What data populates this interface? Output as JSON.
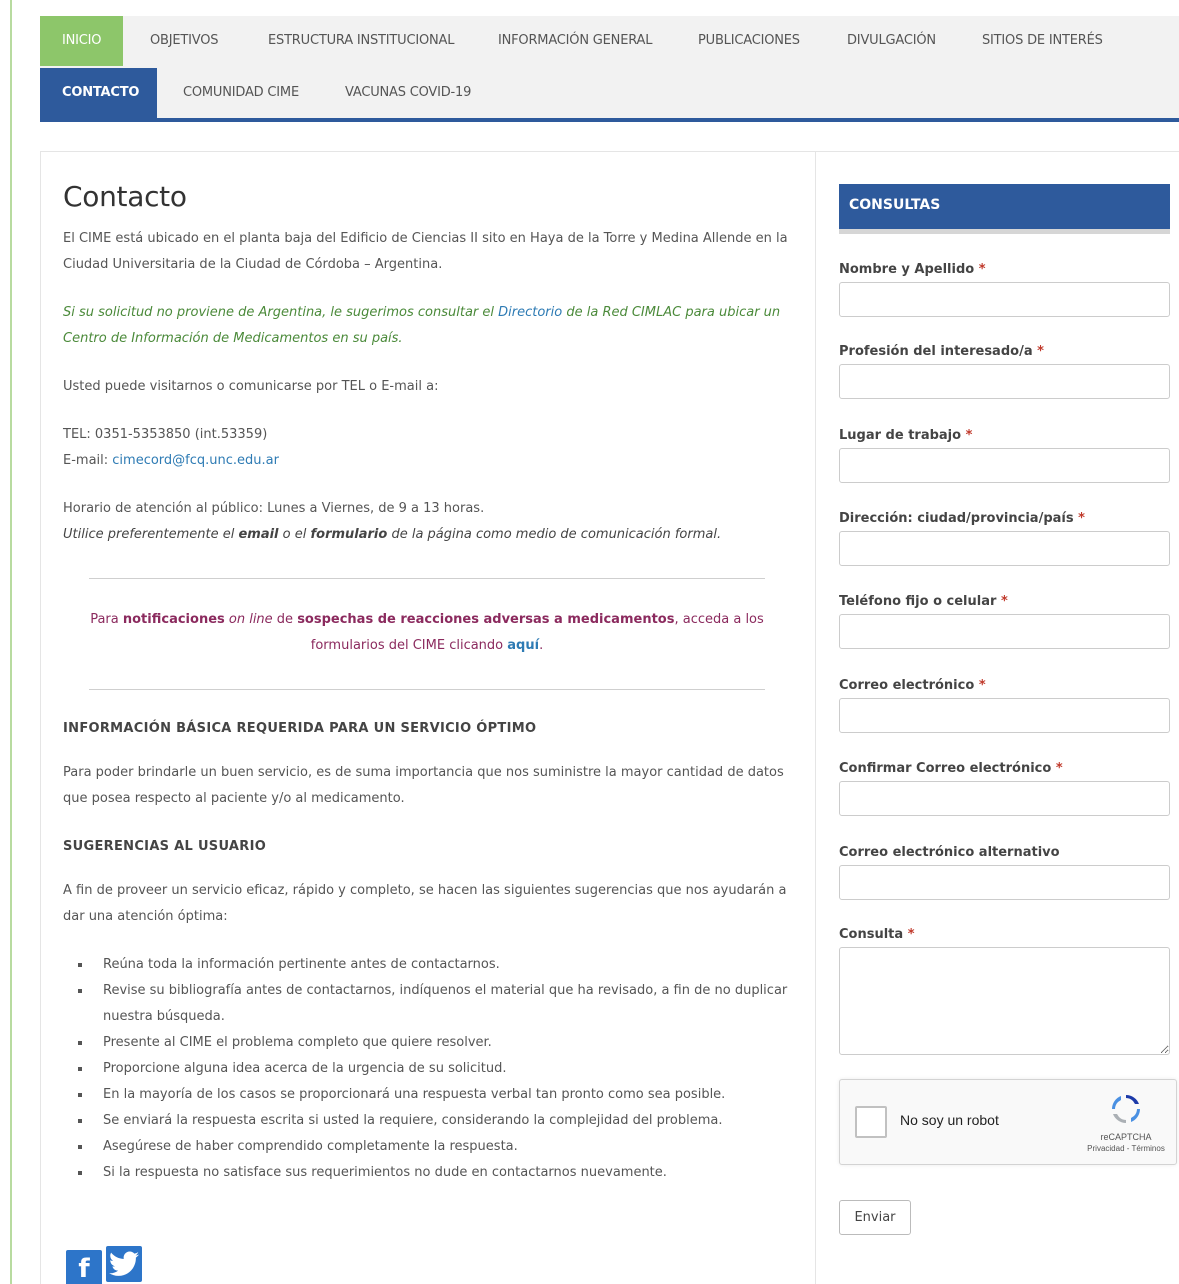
{
  "nav": {
    "row1": [
      "INICIO",
      "OBJETIVOS",
      "ESTRUCTURA INSTITUCIONAL",
      "INFORMACIÓN GENERAL",
      "PUBLICACIONES",
      "DIVULGACIÓN",
      "SITIOS DE INTERÉS"
    ],
    "row2": [
      "CONTACTO",
      "COMUNIDAD CIME",
      "VACUNAS COVID-19"
    ]
  },
  "main": {
    "title": "Contacto",
    "p1": "El CIME está ubicado en el planta baja del Edificio de Ciencias II sito en Haya de la Torre y Medina Allende en la Ciudad Universitaria de la Ciudad de Córdoba – Argentina.",
    "p2_pre": "Si su solicitud no proviene de Argentina, le sugerimos consultar el ",
    "p2_link": "Directorio",
    "p2_post": " de la Red CIMLAC para ubicar un Centro de Información de Medicamentos en su país.",
    "p3": "Usted puede visitarnos o comunicarse por TEL o E-mail a:",
    "tel": "TEL: 0351-5353850 (int.53359)",
    "email_label": "E-mail: ",
    "email": "cimecord@fcq.unc.edu.ar",
    "hours": "Horario de atención al público: Lunes a Viernes, de 9 a 13 horas.",
    "pref_1": "Utilice preferentemente el ",
    "pref_email": "email",
    "pref_2": " o el ",
    "pref_form": "formulario",
    "pref_3": " de la página como medio de comunicación formal.",
    "notice_1": "Para ",
    "notice_b1": "notificaciones",
    "notice_i": " on line",
    "notice_2": " de ",
    "notice_b2": "sospechas de reacciones adversas a medicamentos",
    "notice_3": ", acceda a los formularios del CIME clicando ",
    "notice_link": "aquí",
    "notice_4": ".",
    "h_info": "INFORMACIÓN BÁSICA REQUERIDA PARA UN SERVICIO ÓPTIMO",
    "p_info": "Para poder brindarle un buen servicio, es de suma importancia que nos suministre la mayor cantidad de datos que posea respecto al paciente y/o al medicamento.",
    "h_sug": "SUGERENCIAS AL USUARIO",
    "p_sug": "A fin de proveer un servicio eficaz, rápido y completo, se hacen las siguientes sugerencias que nos ayudarán a dar una atención óptima:",
    "list": [
      "Reúna toda la información pertinente antes de contactarnos.",
      "Revise su bibliografía antes de contactarnos, indíquenos el material que ha revisado, a fin de no duplicar nuestra búsqueda.",
      "Presente al CIME el problema completo que quiere resolver.",
      "Proporcione alguna idea acerca de la urgencia de su solicitud.",
      "En la mayoría de los casos se proporcionará una respuesta verbal tan pronto como sea posible.",
      "Se enviará la respuesta escrita si usted la requiere, considerando la complejidad del problema.",
      "Asegúrese de haber comprendido completamente la respuesta.",
      "Si la respuesta no satisface sus requerimientos no dude en contactarnos nuevamente."
    ],
    "fb": "f",
    "tw": "t"
  },
  "form": {
    "title": "CONSULTAS",
    "required_mark": "*",
    "fields": [
      "Nombre y Apellido",
      "Profesión del interesado/a",
      "Lugar de trabajo",
      "Dirección: ciudad/provincia/país",
      "Teléfono fijo o celular",
      "Correo electrónico",
      "Confirmar Correo electrónico",
      "Correo electrónico alternativo",
      "Consulta"
    ],
    "recaptcha_text": "No soy un robot",
    "recaptcha_brand": "reCAPTCHA",
    "recaptcha_links": "Privacidad - Términos",
    "submit": "Enviar"
  },
  "colors": {
    "nav_active_green": "#8dc66a",
    "nav_active_blue": "#2e5a9c",
    "notice": "#8b2a5e"
  }
}
